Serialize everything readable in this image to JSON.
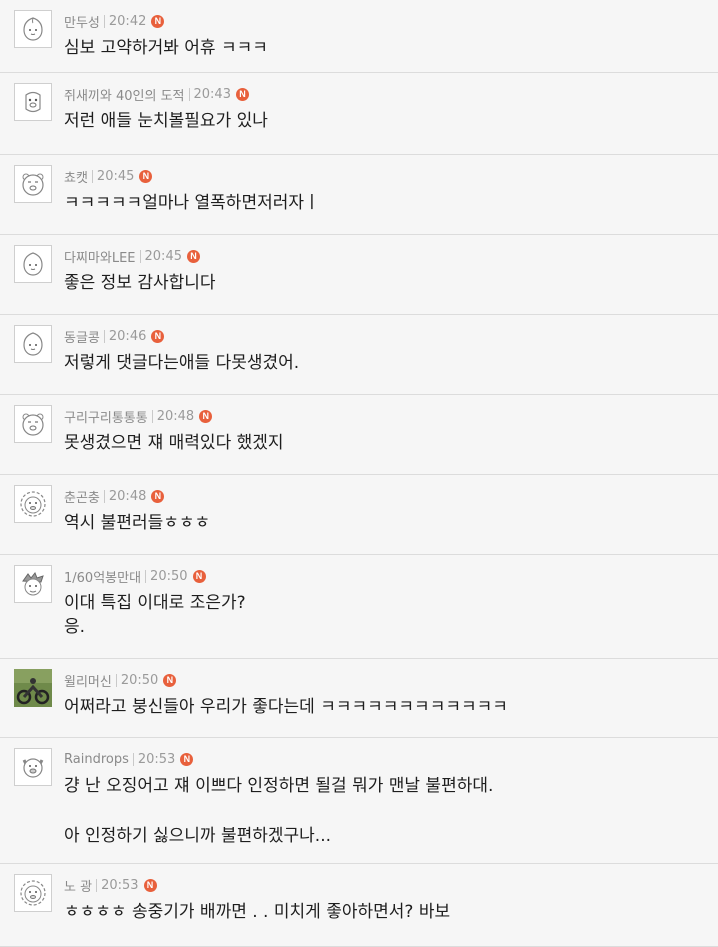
{
  "colors": {
    "background": "#f6f6f6",
    "divider": "#dcdcdc",
    "new_badge": "#e8603c",
    "meta_text": "#8a8a8a"
  },
  "comments": [
    {
      "author": "만두성",
      "time": "20:42",
      "badge": "N",
      "avatar": "apeach-icon",
      "lines": [
        "심보 고약하거봐 어휴 ㅋㅋㅋ"
      ]
    },
    {
      "author": "쥐새끼와 40인의 도적",
      "time": "20:43",
      "badge": "N",
      "avatar": "tube-icon",
      "lines": [
        "저런 애들 눈치볼필요가 있나"
      ]
    },
    {
      "author": "쵸캣",
      "time": "20:45",
      "badge": "N",
      "avatar": "ryan-icon",
      "lines": [
        "ㅋㅋㅋㅋㅋ얼마나 열폭하면저러자ㅣ"
      ]
    },
    {
      "author": "다찌마와LEE",
      "time": "20:45",
      "badge": "N",
      "avatar": "apeach-icon",
      "lines": [
        "좋은 정보 감사합니다"
      ]
    },
    {
      "author": "동글콩",
      "time": "20:46",
      "badge": "N",
      "avatar": "apeach-icon",
      "lines": [
        "저렇게 댓글다는애들 다못생겼어."
      ]
    },
    {
      "author": "구리구리통통통",
      "time": "20:48",
      "badge": "N",
      "avatar": "ryan-icon",
      "lines": [
        "못생겼으면 쟤 매력있다 했겠지"
      ]
    },
    {
      "author": "춘곤충",
      "time": "20:48",
      "badge": "N",
      "avatar": "lion-icon",
      "lines": [
        "역시 불편러들ㅎㅎㅎ"
      ]
    },
    {
      "author": "1/60억봉만대",
      "time": "20:50",
      "badge": "N",
      "avatar": "cartoon-boy-icon",
      "lines": [
        "이대 특집 이대로 조은가?",
        "응."
      ]
    },
    {
      "author": "윌리머신",
      "time": "20:50",
      "badge": "N",
      "avatar": "motorcycle-photo-icon",
      "lines": [
        "어쩌라고 붕신들아 우리가 좋다는데 ㅋㅋㅋㅋㅋㅋㅋㅋㅋㅋㅋㅋ"
      ]
    },
    {
      "author": "Raindrops",
      "time": "20:53",
      "badge": "N",
      "avatar": "dog-icon",
      "lines": [
        "걍 난 오징어고 쟤 이쁘다 인정하면 될걸 뭐가 맨날 불편하대.",
        "",
        "아 인정하기 싫으니까 불편하겠구나..."
      ]
    },
    {
      "author": "노 광",
      "time": "20:53",
      "badge": "N",
      "avatar": "lion-icon",
      "lines": [
        "ㅎㅎㅎㅎ 송중기가 배까면 . . 미치게 좋아하면서? 바보"
      ]
    }
  ]
}
